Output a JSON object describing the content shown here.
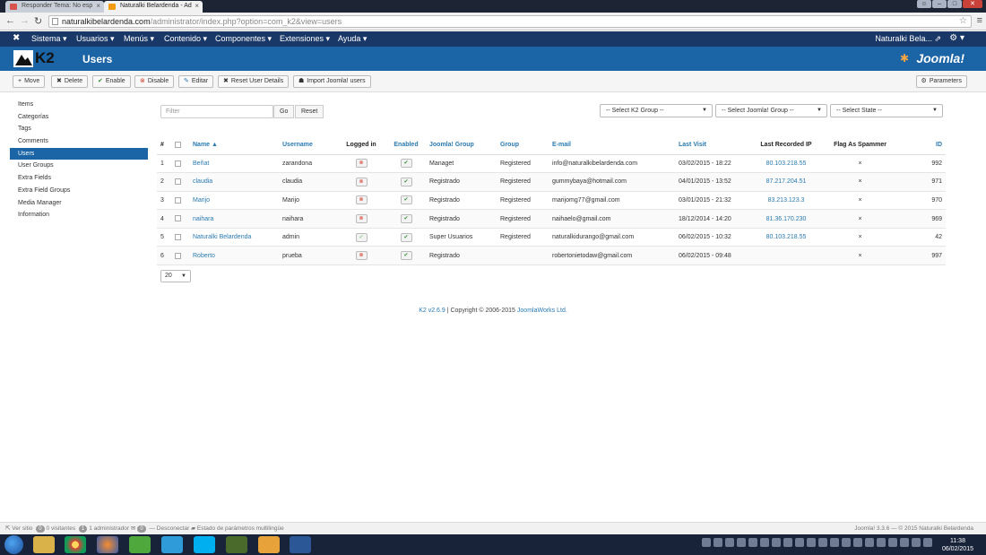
{
  "browser": {
    "tabs": [
      {
        "label": "Responder Tema: No esp",
        "active": false
      },
      {
        "label": "Naturalki Belardenda - Ad",
        "active": true
      }
    ],
    "url_host": "naturalkibelardenda.com",
    "url_path": "/administrator/index.php?option=com_k2&view=users"
  },
  "topnav": {
    "items": [
      "Sistema ▾",
      "Usuarios ▾",
      "Menús ▾",
      "Contenido ▾",
      "Componentes ▾",
      "Extensiones ▾",
      "Ayuda ▾"
    ],
    "site_name": "Naturalki Bela... ⇗"
  },
  "header": {
    "logo_text": "K2",
    "page_title": "Users",
    "brand": "Joomla!"
  },
  "toolbar": {
    "buttons": [
      {
        "icon": "+",
        "label": "Move"
      },
      {
        "icon": "✖",
        "label": "Delete"
      },
      {
        "icon": "✔",
        "label": "Enable"
      },
      {
        "icon": "⊗",
        "label": "Disable"
      },
      {
        "icon": "✎",
        "label": "Editar"
      },
      {
        "icon": "✖",
        "label": "Reset User Details"
      },
      {
        "icon": "☗",
        "label": "Import Joomla! users"
      }
    ],
    "parameters_label": "Parameters"
  },
  "sidebar": {
    "items": [
      "Items",
      "Categorías",
      "Tags",
      "Comments",
      "Users",
      "User Groups",
      "Extra Fields",
      "Extra Field Groups",
      "Media Manager",
      "Information"
    ],
    "active_index": 4
  },
  "filters": {
    "search_placeholder": "Filter",
    "go_label": "Go",
    "reset_label": "Reset",
    "k2_group": "-- Select K2 Group --",
    "joomla_group": "-- Select Joomla! Group --",
    "state": "-- Select State --"
  },
  "table": {
    "headers": [
      "#",
      "",
      "Name ▲",
      "Username",
      "Logged in",
      "Enabled",
      "Joomla! Group",
      "Group",
      "E-mail",
      "Last Visit",
      "Last Recorded IP",
      "Flag As Spammer",
      "ID"
    ],
    "rows": [
      {
        "num": "1",
        "name": "Beñat",
        "username": "zarandona",
        "logged_in": false,
        "enabled": true,
        "joomla_group": "Managet",
        "group": "Registered",
        "email": "info@naturalkibelardenda.com",
        "last_visit": "03/02/2015 - 18:22",
        "ip": "80.103.218.55",
        "spam": "×",
        "id": "992"
      },
      {
        "num": "2",
        "name": "claudia",
        "username": "claudia",
        "logged_in": false,
        "enabled": true,
        "joomla_group": "Registrado",
        "group": "Registered",
        "email": "gummybaya@hotmail.com",
        "last_visit": "04/01/2015 - 13:52",
        "ip": "87.217.204.51",
        "spam": "×",
        "id": "971"
      },
      {
        "num": "3",
        "name": "Marijo",
        "username": "Marijo",
        "logged_in": false,
        "enabled": true,
        "joomla_group": "Registrado",
        "group": "Registered",
        "email": "marijomg77@gmail.com",
        "last_visit": "03/01/2015 - 21:32",
        "ip": "83.213.123.3",
        "spam": "×",
        "id": "970"
      },
      {
        "num": "4",
        "name": "naihara",
        "username": "naihara",
        "logged_in": false,
        "enabled": true,
        "joomla_group": "Registrado",
        "group": "Registered",
        "email": "naihaelo@gmail.com",
        "last_visit": "18/12/2014 - 14:20",
        "ip": "81.36.170.230",
        "spam": "×",
        "id": "969"
      },
      {
        "num": "5",
        "name": "Naturalki Belardenda",
        "username": "admin",
        "logged_in": true,
        "enabled": true,
        "joomla_group": "Super Usuarios",
        "group": "Registered",
        "email": "naturalkidurango@gmail.com",
        "last_visit": "06/02/2015 - 10:32",
        "ip": "80.103.218.55",
        "spam": "×",
        "id": "42"
      },
      {
        "num": "6",
        "name": "Roberto",
        "username": "prueba",
        "logged_in": false,
        "enabled": true,
        "joomla_group": "Registrado",
        "group": "",
        "email": "robertonietodaw@gmail.com",
        "last_visit": "06/02/2015 - 09:48",
        "ip": "",
        "spam": "×",
        "id": "997"
      }
    ]
  },
  "pagination": {
    "per_page": "20"
  },
  "footer": {
    "version_link": "K2 v2.6.9",
    "copyright": " | Copyright © 2006-2015 ",
    "company_link": "JoomlaWorks Ltd."
  },
  "statusbar": {
    "view_site": "Ver sitio",
    "visitors_count": "0",
    "visitors_label": "0 visitantes",
    "admins_count": "1",
    "admins_label": "1 administrador",
    "messages_count": "0",
    "logout": "Desconectar",
    "multilang": "Estado de parámetros multilingüe",
    "right_text": "Joomla! 3.3.6 — © 2015 Naturalki Belardenda"
  },
  "taskbar": {
    "time": "11:38",
    "date": "06/02/2015"
  },
  "colors": {
    "nav": "#1a3867",
    "header": "#1b64a5",
    "link": "#2a7ab0"
  }
}
